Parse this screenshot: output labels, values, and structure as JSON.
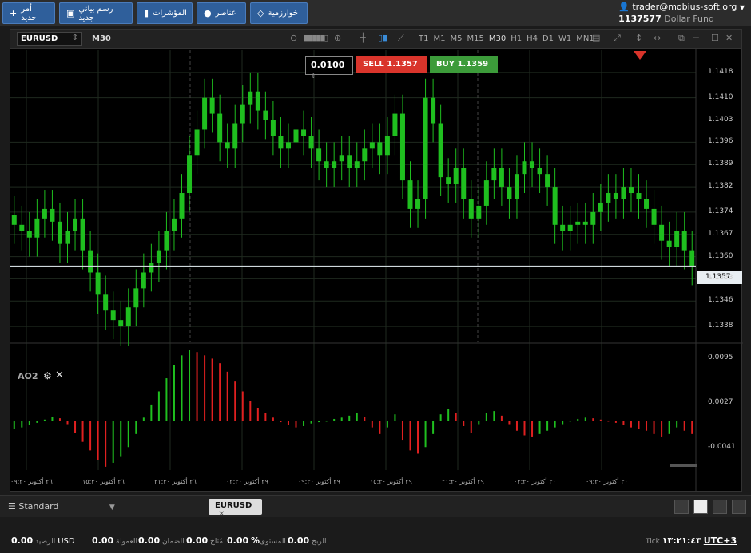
{
  "toolbar": {
    "new_order": "أمر جديد",
    "new_chart": "رسم بياني جديد",
    "indicators": "المؤشرات",
    "elements": "عناصر",
    "algorithms": "خوارزمية"
  },
  "account": {
    "user": "trader@mobius-soft.org",
    "number": "1137577",
    "fund": "Dollar Fund"
  },
  "chart": {
    "symbol": "EURUSD",
    "timeframe": "M30",
    "timeframes": [
      "T1",
      "M1",
      "M5",
      "M15",
      "M30",
      "H1",
      "H4",
      "D1",
      "W1",
      "MN1"
    ],
    "active_tf": "M30",
    "lot": "0.0100",
    "sell_label": "SELL",
    "sell_price": "1.1357",
    "buy_label": "BUY",
    "buy_price": "1.1359",
    "current_price": "1.1357",
    "y_ticks": [
      "1.1418",
      "1.1410",
      "1.1403",
      "1.1396",
      "1.1389",
      "1.1382",
      "1.1374",
      "1.1367",
      "1.1360",
      "1.1353",
      "1.1346",
      "1.1338"
    ],
    "ind_name": "AO2",
    "ind_ticks": [
      "0.0095",
      "0.0027",
      "-0.0041"
    ],
    "x_ticks": [
      "٢٦ أكتوبر ٠٩:٣٠",
      "٢٦ أكتوبر ١٥:٣٠",
      "٢٦ أكتوبر ٢١:٣٠",
      "٢٩ أكتوبر ٠٣:٣٠",
      "٢٩ أكتوبر ٠٩:٣٠",
      "٢٩ أكتوبر ١٥:٣٠",
      "٢٩ أكتوبر ٢١:٣٠",
      "٣٠ أكتوبر ٠٣:٣٠",
      "٣٠ أكتوبر ٠٩:٣٠"
    ],
    "colors": {
      "up": "#1fbf1f",
      "down": "#e02020",
      "grid": "#1f2a1f"
    }
  },
  "chart_data": {
    "type": "candlestick",
    "series_closes": [
      1.137,
      1.1368,
      1.1366,
      1.1372,
      1.1375,
      1.1371,
      1.1364,
      1.1368,
      1.1372,
      1.1362,
      1.1355,
      1.1348,
      1.1343,
      1.134,
      1.1338,
      1.1344,
      1.135,
      1.1355,
      1.1358,
      1.1362,
      1.1368,
      1.1372,
      1.138,
      1.1392,
      1.14,
      1.141,
      1.1405,
      1.1396,
      1.1394,
      1.1402,
      1.1408,
      1.1412,
      1.1406,
      1.1403,
      1.1398,
      1.1394,
      1.1396,
      1.14,
      1.1398,
      1.1394,
      1.139,
      1.1388,
      1.139,
      1.1392,
      1.1388,
      1.139,
      1.1394,
      1.1396,
      1.1392,
      1.1398,
      1.1405,
      1.1384,
      1.1375,
      1.1378,
      1.141,
      1.1402,
      1.1385,
      1.1383,
      1.1388,
      1.1378,
      1.1372,
      1.1376,
      1.1384,
      1.1388,
      1.1382,
      1.1378,
      1.1386,
      1.139,
      1.1388,
      1.1386,
      1.1382,
      1.137,
      1.1368,
      1.137,
      1.1371,
      1.137,
      1.1374,
      1.1377,
      1.138,
      1.1378,
      1.1382,
      1.138,
      1.1378,
      1.1375,
      1.137,
      1.1365,
      1.1363,
      1.1368,
      1.1362,
      1.1357
    ],
    "ao_values": [
      -0.0012,
      -0.001,
      -0.0006,
      -0.0003,
      0.0002,
      0.0006,
      0.0004,
      -0.0005,
      -0.0018,
      -0.0032,
      -0.0045,
      -0.006,
      -0.007,
      -0.0064,
      -0.0055,
      -0.004,
      -0.002,
      0.0005,
      0.0025,
      0.0045,
      0.0065,
      0.0085,
      0.01,
      0.0108,
      0.0105,
      0.01,
      0.0095,
      0.0088,
      0.0075,
      0.006,
      0.0045,
      0.003,
      0.002,
      0.0012,
      0.0005,
      -0.0002,
      -0.0006,
      -0.001,
      -0.0008,
      -0.0004,
      -0.0002,
      0.0,
      0.0003,
      0.0005,
      0.0008,
      0.0012,
      0.0006,
      -0.001,
      -0.002,
      -0.001,
      0.001,
      -0.003,
      -0.0045,
      -0.005,
      -0.004,
      -0.002,
      0.001,
      0.0018,
      0.0012,
      -0.0008,
      -0.0018,
      -0.0005,
      0.0012,
      0.0015,
      0.0008,
      -0.0005,
      -0.0015,
      -0.0022,
      -0.0025,
      -0.002,
      -0.0015,
      -0.001,
      -0.0005,
      0.0,
      0.0003,
      0.0005,
      0.0004,
      0.0002,
      0.0,
      -0.0003,
      -0.0006,
      -0.001,
      -0.0012,
      -0.0015,
      -0.002,
      -0.0025,
      -0.002,
      -0.001,
      -0.0015,
      -0.002
    ],
    "y_range": [
      1.1333,
      1.1425
    ],
    "ind_range": [
      -0.0075,
      0.0115
    ]
  },
  "workspace": {
    "name": "Standard",
    "tab": "EURUSD"
  },
  "status": {
    "balance_label": "الرصيد",
    "balance": "0.00",
    "currency": "USD",
    "commission_label": "العمولة",
    "commission": "0.00",
    "margin_label": "الضمان",
    "margin": "0.00",
    "free_label": "مُتاح",
    "free": "0.00",
    "level_label": "المستوى",
    "level": "%",
    "profit_label": "الربح",
    "profit": "0.00",
    "tick": "Tick",
    "time": "١٣:٢١:٤٣",
    "tz": "UTC+3"
  }
}
